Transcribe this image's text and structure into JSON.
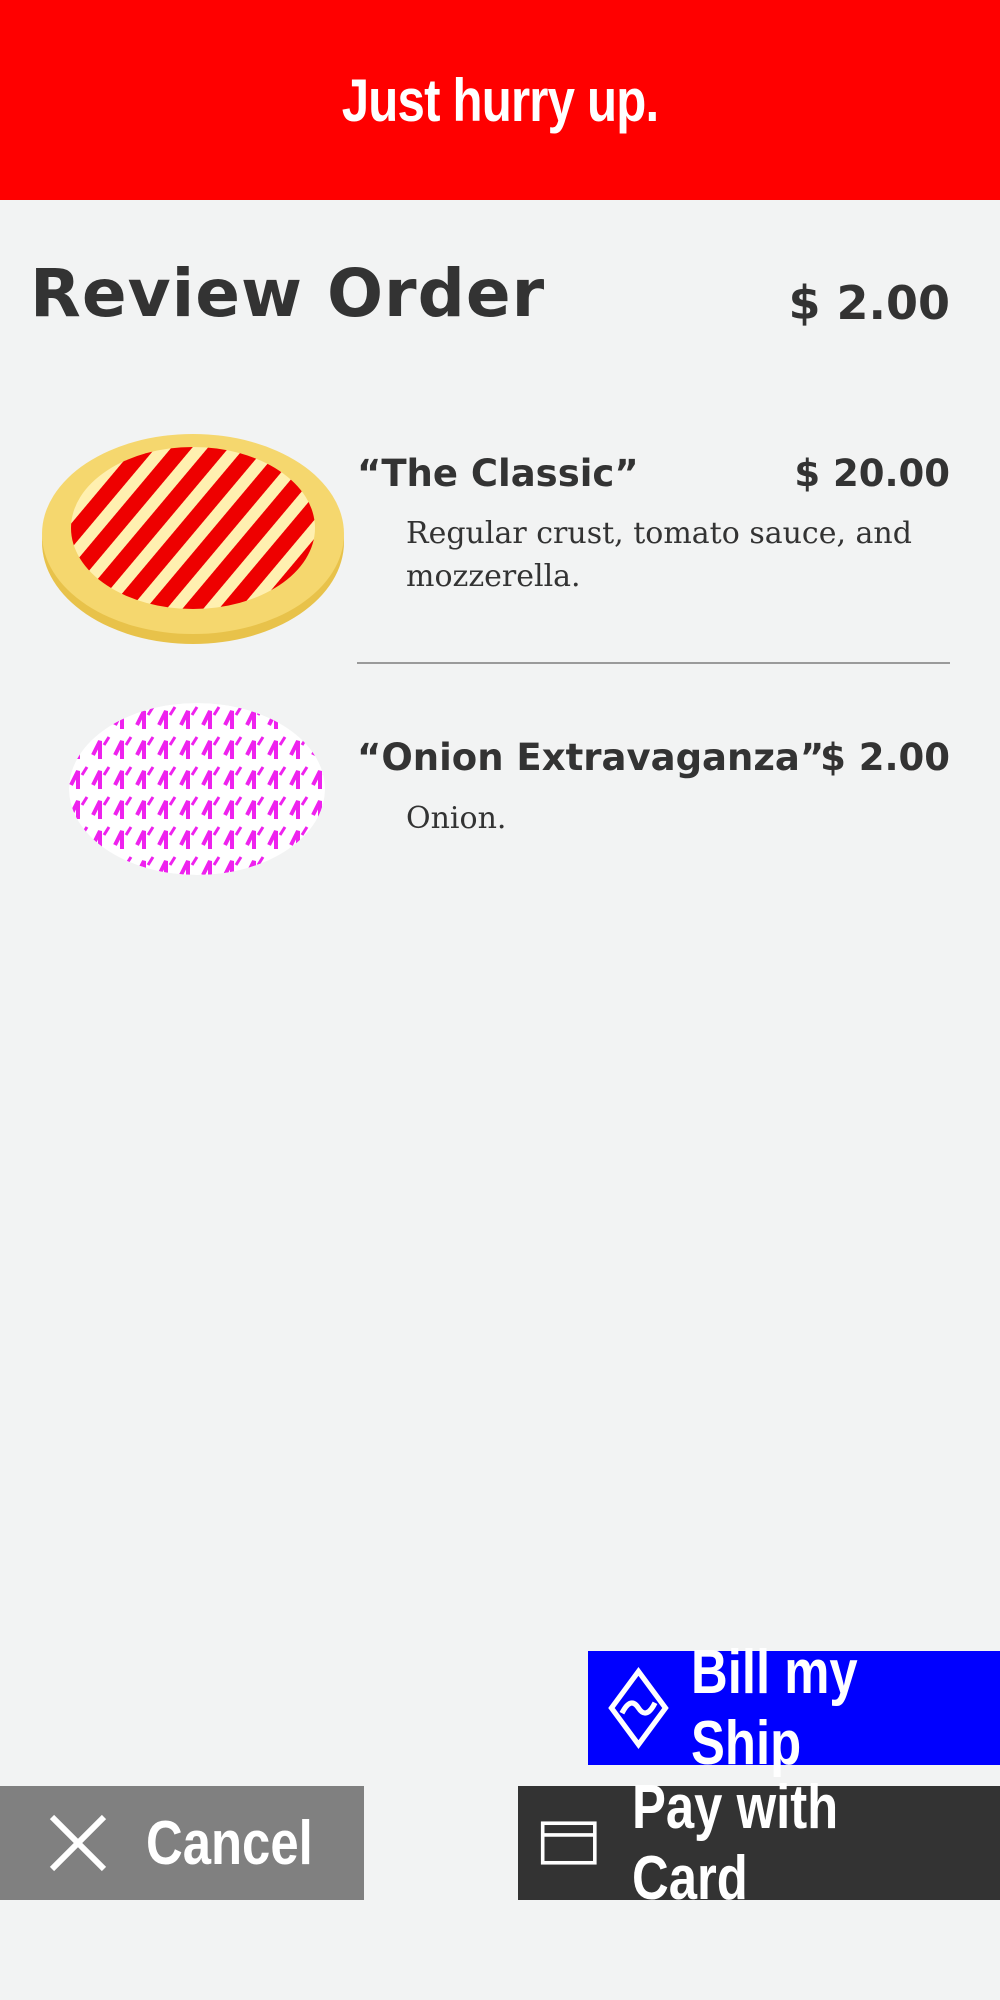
{
  "banner": {
    "text": "Just hurry up."
  },
  "page": {
    "title": "Review Order",
    "total": "$ 2.00"
  },
  "items": [
    {
      "name": "“The Classic”",
      "price": "$ 20.00",
      "description": "Regular crust, tomato sauce, and mozzerella."
    },
    {
      "name": "“Onion Extravaganza”",
      "price": "$ 2.00",
      "description": "Onion."
    }
  ],
  "actions": {
    "bill_label": "Bill my Ship",
    "cancel_label": "Cancel",
    "pay_label": "Pay with Card"
  },
  "icons": {
    "bill": "ship-diamond-icon",
    "cancel": "close-icon",
    "pay": "credit-card-icon"
  },
  "colors": {
    "banner": "#ff0000",
    "bill_button": "#0000ff",
    "cancel_button": "#808080",
    "pay_button": "#333333",
    "background": "#f2f3f3",
    "classic_sauce": "#ee0000",
    "classic_crust": "#f5d76e",
    "onion_pattern": "#ee22ee"
  }
}
